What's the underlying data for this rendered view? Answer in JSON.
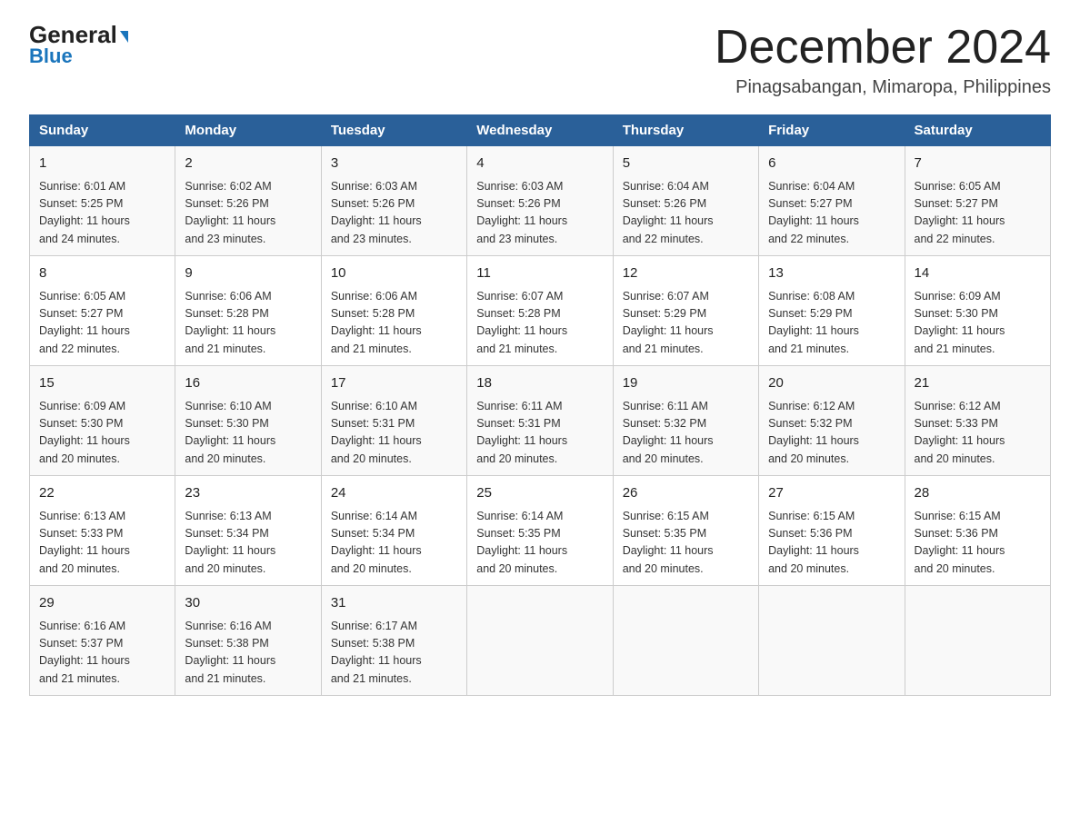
{
  "header": {
    "logo_line1": "General",
    "logo_line2": "Blue",
    "title": "December 2024",
    "subtitle": "Pinagsabangan, Mimaropa, Philippines"
  },
  "columns": [
    "Sunday",
    "Monday",
    "Tuesday",
    "Wednesday",
    "Thursday",
    "Friday",
    "Saturday"
  ],
  "weeks": [
    [
      {
        "day": "1",
        "sunrise": "6:01 AM",
        "sunset": "5:25 PM",
        "daylight": "11 hours and 24 minutes."
      },
      {
        "day": "2",
        "sunrise": "6:02 AM",
        "sunset": "5:26 PM",
        "daylight": "11 hours and 23 minutes."
      },
      {
        "day": "3",
        "sunrise": "6:03 AM",
        "sunset": "5:26 PM",
        "daylight": "11 hours and 23 minutes."
      },
      {
        "day": "4",
        "sunrise": "6:03 AM",
        "sunset": "5:26 PM",
        "daylight": "11 hours and 23 minutes."
      },
      {
        "day": "5",
        "sunrise": "6:04 AM",
        "sunset": "5:26 PM",
        "daylight": "11 hours and 22 minutes."
      },
      {
        "day": "6",
        "sunrise": "6:04 AM",
        "sunset": "5:27 PM",
        "daylight": "11 hours and 22 minutes."
      },
      {
        "day": "7",
        "sunrise": "6:05 AM",
        "sunset": "5:27 PM",
        "daylight": "11 hours and 22 minutes."
      }
    ],
    [
      {
        "day": "8",
        "sunrise": "6:05 AM",
        "sunset": "5:27 PM",
        "daylight": "11 hours and 22 minutes."
      },
      {
        "day": "9",
        "sunrise": "6:06 AM",
        "sunset": "5:28 PM",
        "daylight": "11 hours and 21 minutes."
      },
      {
        "day": "10",
        "sunrise": "6:06 AM",
        "sunset": "5:28 PM",
        "daylight": "11 hours and 21 minutes."
      },
      {
        "day": "11",
        "sunrise": "6:07 AM",
        "sunset": "5:28 PM",
        "daylight": "11 hours and 21 minutes."
      },
      {
        "day": "12",
        "sunrise": "6:07 AM",
        "sunset": "5:29 PM",
        "daylight": "11 hours and 21 minutes."
      },
      {
        "day": "13",
        "sunrise": "6:08 AM",
        "sunset": "5:29 PM",
        "daylight": "11 hours and 21 minutes."
      },
      {
        "day": "14",
        "sunrise": "6:09 AM",
        "sunset": "5:30 PM",
        "daylight": "11 hours and 21 minutes."
      }
    ],
    [
      {
        "day": "15",
        "sunrise": "6:09 AM",
        "sunset": "5:30 PM",
        "daylight": "11 hours and 20 minutes."
      },
      {
        "day": "16",
        "sunrise": "6:10 AM",
        "sunset": "5:30 PM",
        "daylight": "11 hours and 20 minutes."
      },
      {
        "day": "17",
        "sunrise": "6:10 AM",
        "sunset": "5:31 PM",
        "daylight": "11 hours and 20 minutes."
      },
      {
        "day": "18",
        "sunrise": "6:11 AM",
        "sunset": "5:31 PM",
        "daylight": "11 hours and 20 minutes."
      },
      {
        "day": "19",
        "sunrise": "6:11 AM",
        "sunset": "5:32 PM",
        "daylight": "11 hours and 20 minutes."
      },
      {
        "day": "20",
        "sunrise": "6:12 AM",
        "sunset": "5:32 PM",
        "daylight": "11 hours and 20 minutes."
      },
      {
        "day": "21",
        "sunrise": "6:12 AM",
        "sunset": "5:33 PM",
        "daylight": "11 hours and 20 minutes."
      }
    ],
    [
      {
        "day": "22",
        "sunrise": "6:13 AM",
        "sunset": "5:33 PM",
        "daylight": "11 hours and 20 minutes."
      },
      {
        "day": "23",
        "sunrise": "6:13 AM",
        "sunset": "5:34 PM",
        "daylight": "11 hours and 20 minutes."
      },
      {
        "day": "24",
        "sunrise": "6:14 AM",
        "sunset": "5:34 PM",
        "daylight": "11 hours and 20 minutes."
      },
      {
        "day": "25",
        "sunrise": "6:14 AM",
        "sunset": "5:35 PM",
        "daylight": "11 hours and 20 minutes."
      },
      {
        "day": "26",
        "sunrise": "6:15 AM",
        "sunset": "5:35 PM",
        "daylight": "11 hours and 20 minutes."
      },
      {
        "day": "27",
        "sunrise": "6:15 AM",
        "sunset": "5:36 PM",
        "daylight": "11 hours and 20 minutes."
      },
      {
        "day": "28",
        "sunrise": "6:15 AM",
        "sunset": "5:36 PM",
        "daylight": "11 hours and 20 minutes."
      }
    ],
    [
      {
        "day": "29",
        "sunrise": "6:16 AM",
        "sunset": "5:37 PM",
        "daylight": "11 hours and 21 minutes."
      },
      {
        "day": "30",
        "sunrise": "6:16 AM",
        "sunset": "5:38 PM",
        "daylight": "11 hours and 21 minutes."
      },
      {
        "day": "31",
        "sunrise": "6:17 AM",
        "sunset": "5:38 PM",
        "daylight": "11 hours and 21 minutes."
      },
      null,
      null,
      null,
      null
    ]
  ],
  "labels": {
    "sunrise": "Sunrise:",
    "sunset": "Sunset:",
    "daylight": "Daylight:"
  }
}
